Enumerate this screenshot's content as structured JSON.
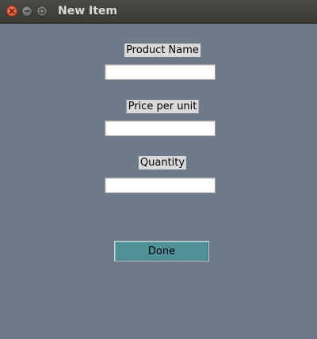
{
  "window": {
    "title": "New Item"
  },
  "form": {
    "product_name_label": "Product Name",
    "product_name_value": "",
    "price_label": "Price per unit",
    "price_value": "",
    "quantity_label": "Quantity",
    "quantity_value": "",
    "done_label": "Done"
  },
  "icons": {
    "close": "close-icon",
    "minimize": "minimize-icon",
    "maximize": "maximize-icon"
  },
  "colors": {
    "background": "#6f7a89",
    "titlebar": "#3f3e3a",
    "close_button": "#e05a3b",
    "done_button": "#4e9098",
    "label_background": "#d9d9d9"
  }
}
